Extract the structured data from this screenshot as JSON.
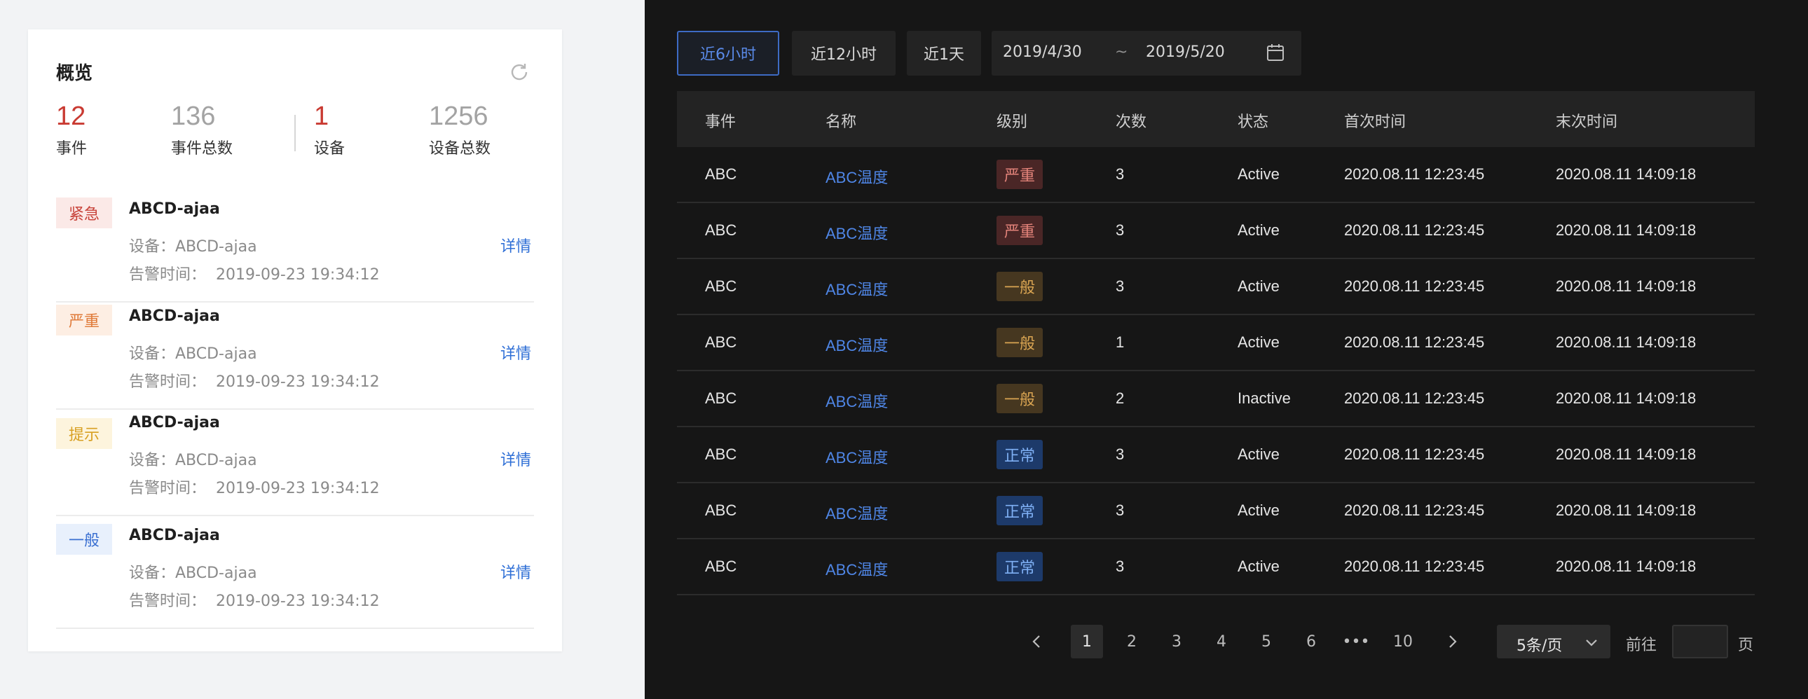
{
  "overview": {
    "title": "概览",
    "stats": [
      {
        "value": "12",
        "label": "事件",
        "highlight": true
      },
      {
        "value": "136",
        "label": "事件总数",
        "highlight": false
      },
      {
        "value": "1",
        "label": "设备",
        "highlight": true
      },
      {
        "value": "1256",
        "label": "设备总数",
        "highlight": false
      }
    ],
    "alerts": [
      {
        "level": "紧急",
        "name": "ABCD-ajaa",
        "device": "设备：ABCD-ajaa",
        "time_label": "告警时间：",
        "time": "2019-09-23 19:34:12",
        "detail": "详情"
      },
      {
        "level": "严重",
        "name": "ABCD-ajaa",
        "device": "设备：ABCD-ajaa",
        "time_label": "告警时间：",
        "time": "2019-09-23 19:34:12",
        "detail": "详情"
      },
      {
        "level": "提示",
        "name": "ABCD-ajaa",
        "device": "设备：ABCD-ajaa",
        "time_label": "告警时间：",
        "time": "2019-09-23 19:34:12",
        "detail": "详情"
      },
      {
        "level": "一般",
        "name": "ABCD-ajaa",
        "device": "设备：ABCD-ajaa",
        "time_label": "告警时间：",
        "time": "2019-09-23 19:34:12",
        "detail": "详情"
      }
    ]
  },
  "filters": {
    "buttons": [
      "近6小时",
      "近12小时",
      "近1天"
    ],
    "active_index": 0,
    "date_start": "2019/4/30",
    "date_sep": "~",
    "date_end": "2019/5/20"
  },
  "table": {
    "headers": [
      "事件",
      "名称",
      "级别",
      "次数",
      "状态",
      "首次时间",
      "末次时间"
    ],
    "rows": [
      [
        "ABC",
        "ABC温度",
        "严重",
        "3",
        "Active",
        "2020.08.11 12:23:45",
        "2020.08.11 14:09:18"
      ],
      [
        "ABC",
        "ABC温度",
        "严重",
        "3",
        "Active",
        "2020.08.11 12:23:45",
        "2020.08.11 14:09:18"
      ],
      [
        "ABC",
        "ABC温度",
        "一般",
        "3",
        "Active",
        "2020.08.11 12:23:45",
        "2020.08.11 14:09:18"
      ],
      [
        "ABC",
        "ABC温度",
        "一般",
        "1",
        "Active",
        "2020.08.11 12:23:45",
        "2020.08.11 14:09:18"
      ],
      [
        "ABC",
        "ABC温度",
        "一般",
        "2",
        "Inactive",
        "2020.08.11 12:23:45",
        "2020.08.11 14:09:18"
      ],
      [
        "ABC",
        "ABC温度",
        "正常",
        "3",
        "Active",
        "2020.08.11 12:23:45",
        "2020.08.11 14:09:18"
      ],
      [
        "ABC",
        "ABC温度",
        "正常",
        "3",
        "Active",
        "2020.08.11 12:23:45",
        "2020.08.11 14:09:18"
      ],
      [
        "ABC",
        "ABC温度",
        "正常",
        "3",
        "Active",
        "2020.08.11 12:23:45",
        "2020.08.11 14:09:18"
      ]
    ]
  },
  "pagination": {
    "pages": [
      "1",
      "2",
      "3",
      "4",
      "5",
      "6",
      "•••",
      "10"
    ],
    "current": "1",
    "page_size": "5条/页",
    "goto_label": "前往",
    "goto_value": "",
    "page_suffix": "页"
  },
  "icons": {
    "refresh": "refresh-icon",
    "calendar": "calendar-icon",
    "prev": "chevron-left-icon",
    "next": "chevron-right-icon",
    "dropdown": "chevron-down-icon"
  },
  "colors": {
    "accent": "#3e6bc4",
    "link": "#4f86e6",
    "urgent": "#c8433a",
    "serious": "#e07b3a",
    "hint": "#d8a023",
    "normal": "#3a6fd1"
  }
}
